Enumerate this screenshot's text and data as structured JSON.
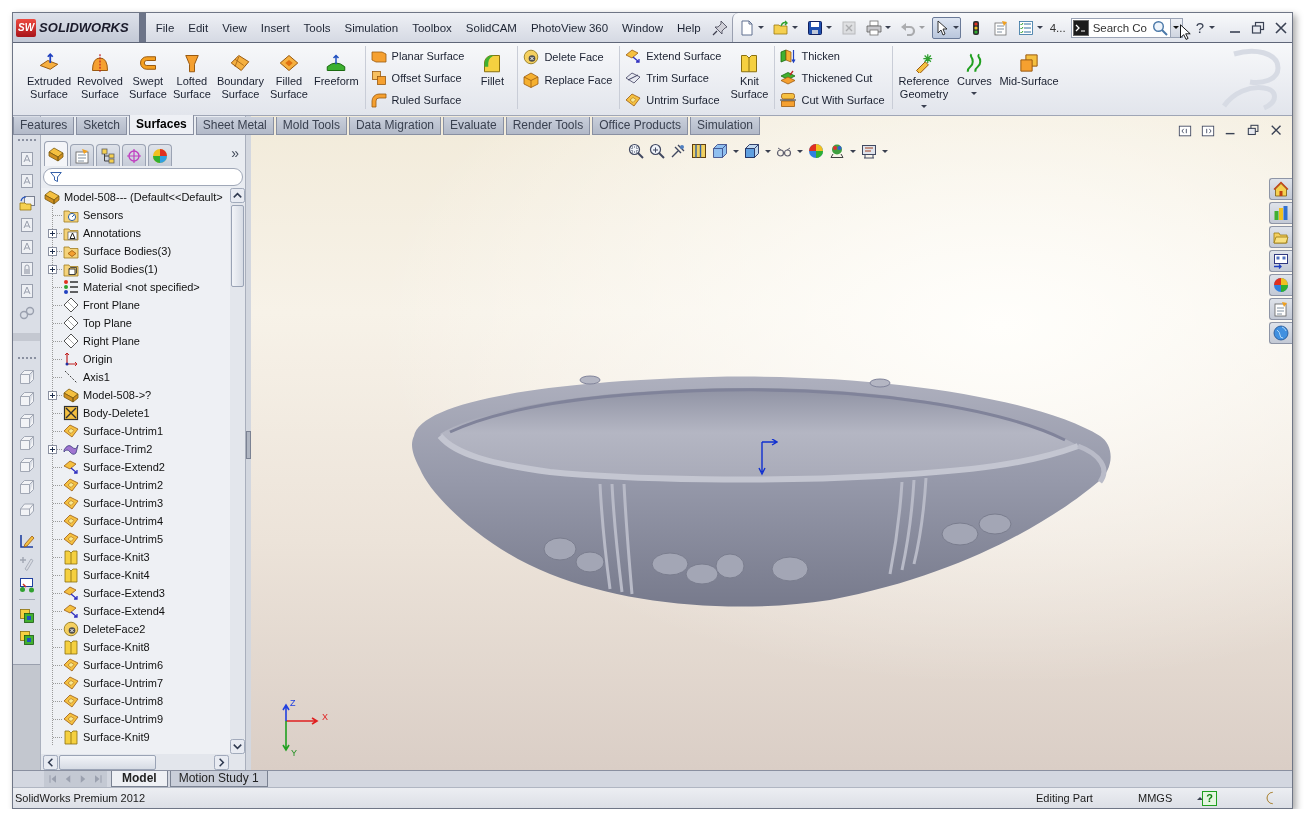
{
  "title_bar": {
    "logo_mark": "SW",
    "logo": "SOLIDWORKS",
    "menu": [
      "File",
      "Edit",
      "View",
      "Insert",
      "Tools",
      "Simulation",
      "Toolbox",
      "SolidCAM",
      "PhotoView 360",
      "Window",
      "Help"
    ],
    "quick_access": [
      {
        "kind": "new",
        "dropdown": true,
        "disabled": false,
        "pressed": false
      },
      {
        "kind": "open",
        "dropdown": true,
        "disabled": false,
        "pressed": false
      },
      {
        "kind": "save",
        "dropdown": true,
        "disabled": false,
        "pressed": false
      },
      {
        "kind": "close",
        "dropdown": false,
        "disabled": true,
        "pressed": false
      },
      {
        "kind": "print",
        "dropdown": true,
        "disabled": false,
        "pressed": false
      },
      {
        "kind": "undo",
        "dropdown": true,
        "disabled": true,
        "pressed": false
      },
      {
        "kind": "select",
        "dropdown": true,
        "disabled": false,
        "pressed": true
      },
      {
        "kind": "rebuild",
        "dropdown": false,
        "disabled": false,
        "pressed": false
      },
      {
        "kind": "properties",
        "dropdown": false,
        "disabled": false,
        "pressed": false
      },
      {
        "kind": "options",
        "dropdown": true,
        "disabled": false,
        "pressed": false
      }
    ],
    "overflow_label": "4...",
    "search": {
      "placeholder": "Search Co"
    },
    "help_glyph": "?"
  },
  "command_manager": {
    "groups": [
      {
        "columns": [
          {
            "kind": "large",
            "items": [
              {
                "label": "Extruded Surface",
                "dropdown": false
              },
              {
                "label": "Revolved Surface",
                "dropdown": false
              },
              {
                "label": "Swept Surface",
                "dropdown": false
              },
              {
                "label": "Lofted Surface",
                "dropdown": false
              },
              {
                "label": "Boundary Surface",
                "dropdown": false
              },
              {
                "label": "Filled Surface",
                "dropdown": false
              },
              {
                "label": "Freeform",
                "dropdown": false
              }
            ]
          }
        ]
      },
      {
        "columns": [
          {
            "kind": "stack",
            "items": [
              {
                "label": "Planar Surface"
              },
              {
                "label": "Offset Surface"
              },
              {
                "label": "Ruled Surface"
              }
            ]
          },
          {
            "kind": "large",
            "items": [
              {
                "label": "Fillet",
                "dropdown": false
              }
            ]
          }
        ]
      },
      {
        "columns": [
          {
            "kind": "stack",
            "items": [
              {
                "label": "Delete Face"
              },
              {
                "label": "Replace Face"
              }
            ]
          }
        ]
      },
      {
        "columns": [
          {
            "kind": "stack",
            "items": [
              {
                "label": "Extend Surface"
              },
              {
                "label": "Trim Surface"
              },
              {
                "label": "Untrim Surface"
              }
            ]
          },
          {
            "kind": "large",
            "items": [
              {
                "label": "Knit Surface",
                "dropdown": false
              }
            ]
          }
        ]
      },
      {
        "columns": [
          {
            "kind": "stack",
            "items": [
              {
                "label": "Thicken"
              },
              {
                "label": "Thickened Cut"
              },
              {
                "label": "Cut With Surface"
              }
            ]
          }
        ]
      },
      {
        "columns": [
          {
            "kind": "large",
            "items": [
              {
                "label": "Reference Geometry",
                "dropdown": true
              },
              {
                "label": "Curves",
                "dropdown": true
              },
              {
                "label": "Mid-Surface",
                "dropdown": false
              }
            ]
          }
        ]
      }
    ]
  },
  "tabs": [
    {
      "label": "Features",
      "selected": false
    },
    {
      "label": "Sketch",
      "selected": false
    },
    {
      "label": "Surfaces",
      "selected": true
    },
    {
      "label": "Sheet Metal",
      "selected": false
    },
    {
      "label": "Mold Tools",
      "selected": false
    },
    {
      "label": "Data Migration",
      "selected": false
    },
    {
      "label": "Evaluate",
      "selected": false
    },
    {
      "label": "Render Tools",
      "selected": false
    },
    {
      "label": "Office Products",
      "selected": false
    },
    {
      "label": "Simulation",
      "selected": false
    }
  ],
  "feature_manager": {
    "tabs": [
      {
        "selected": true
      },
      {
        "selected": false
      },
      {
        "selected": false
      },
      {
        "selected": false
      },
      {
        "selected": false
      }
    ],
    "more_glyph": "»",
    "tree": {
      "label": "Model-508--- (Default<<Default>",
      "kind": "part",
      "children": [
        {
          "label": "Sensors",
          "kind": "sensors"
        },
        {
          "label": "Annotations",
          "kind": "annotations",
          "expanded": false
        },
        {
          "label": "Surface Bodies(3)",
          "kind": "surfacebodies",
          "expanded": false
        },
        {
          "label": "Solid Bodies(1)",
          "kind": "solidbodies",
          "expanded": false
        },
        {
          "label": "Material <not specified>",
          "kind": "material"
        },
        {
          "label": "Front Plane",
          "kind": "plane"
        },
        {
          "label": "Top Plane",
          "kind": "plane"
        },
        {
          "label": "Right Plane",
          "kind": "plane"
        },
        {
          "label": "Origin",
          "kind": "origin"
        },
        {
          "label": "Axis1",
          "kind": "axis"
        },
        {
          "label": "Model-508->?",
          "kind": "part",
          "expanded": false
        },
        {
          "label": "Body-Delete1",
          "kind": "bodydelete"
        },
        {
          "label": "Surface-Untrim1",
          "kind": "untrim"
        },
        {
          "label": "Surface-Trim2",
          "kind": "trim",
          "expanded": false
        },
        {
          "label": "Surface-Extend2",
          "kind": "extend"
        },
        {
          "label": "Surface-Untrim2",
          "kind": "untrim"
        },
        {
          "label": "Surface-Untrim3",
          "kind": "untrim"
        },
        {
          "label": "Surface-Untrim4",
          "kind": "untrim"
        },
        {
          "label": "Surface-Untrim5",
          "kind": "untrim"
        },
        {
          "label": "Surface-Knit3",
          "kind": "knit"
        },
        {
          "label": "Surface-Knit4",
          "kind": "knit"
        },
        {
          "label": "Surface-Extend3",
          "kind": "extend"
        },
        {
          "label": "Surface-Extend4",
          "kind": "extend"
        },
        {
          "label": "DeleteFace2",
          "kind": "deleteface"
        },
        {
          "label": "Surface-Knit8",
          "kind": "knit"
        },
        {
          "label": "Surface-Untrim6",
          "kind": "untrim"
        },
        {
          "label": "Surface-Untrim7",
          "kind": "untrim"
        },
        {
          "label": "Surface-Untrim8",
          "kind": "untrim"
        },
        {
          "label": "Surface-Untrim9",
          "kind": "untrim"
        },
        {
          "label": "Surface-Knit9",
          "kind": "knit"
        }
      ]
    }
  },
  "viewport": {
    "triad": {
      "x_label": "X",
      "y_label": "Y",
      "z_label": "Z"
    }
  },
  "bottom_tabs": [
    {
      "label": "Model",
      "selected": true
    },
    {
      "label": "Motion Study 1",
      "selected": false
    }
  ],
  "status_bar": {
    "product": "SolidWorks Premium 2012",
    "mode": "Editing Part",
    "units": "MMGS",
    "help_glyph": "?"
  }
}
